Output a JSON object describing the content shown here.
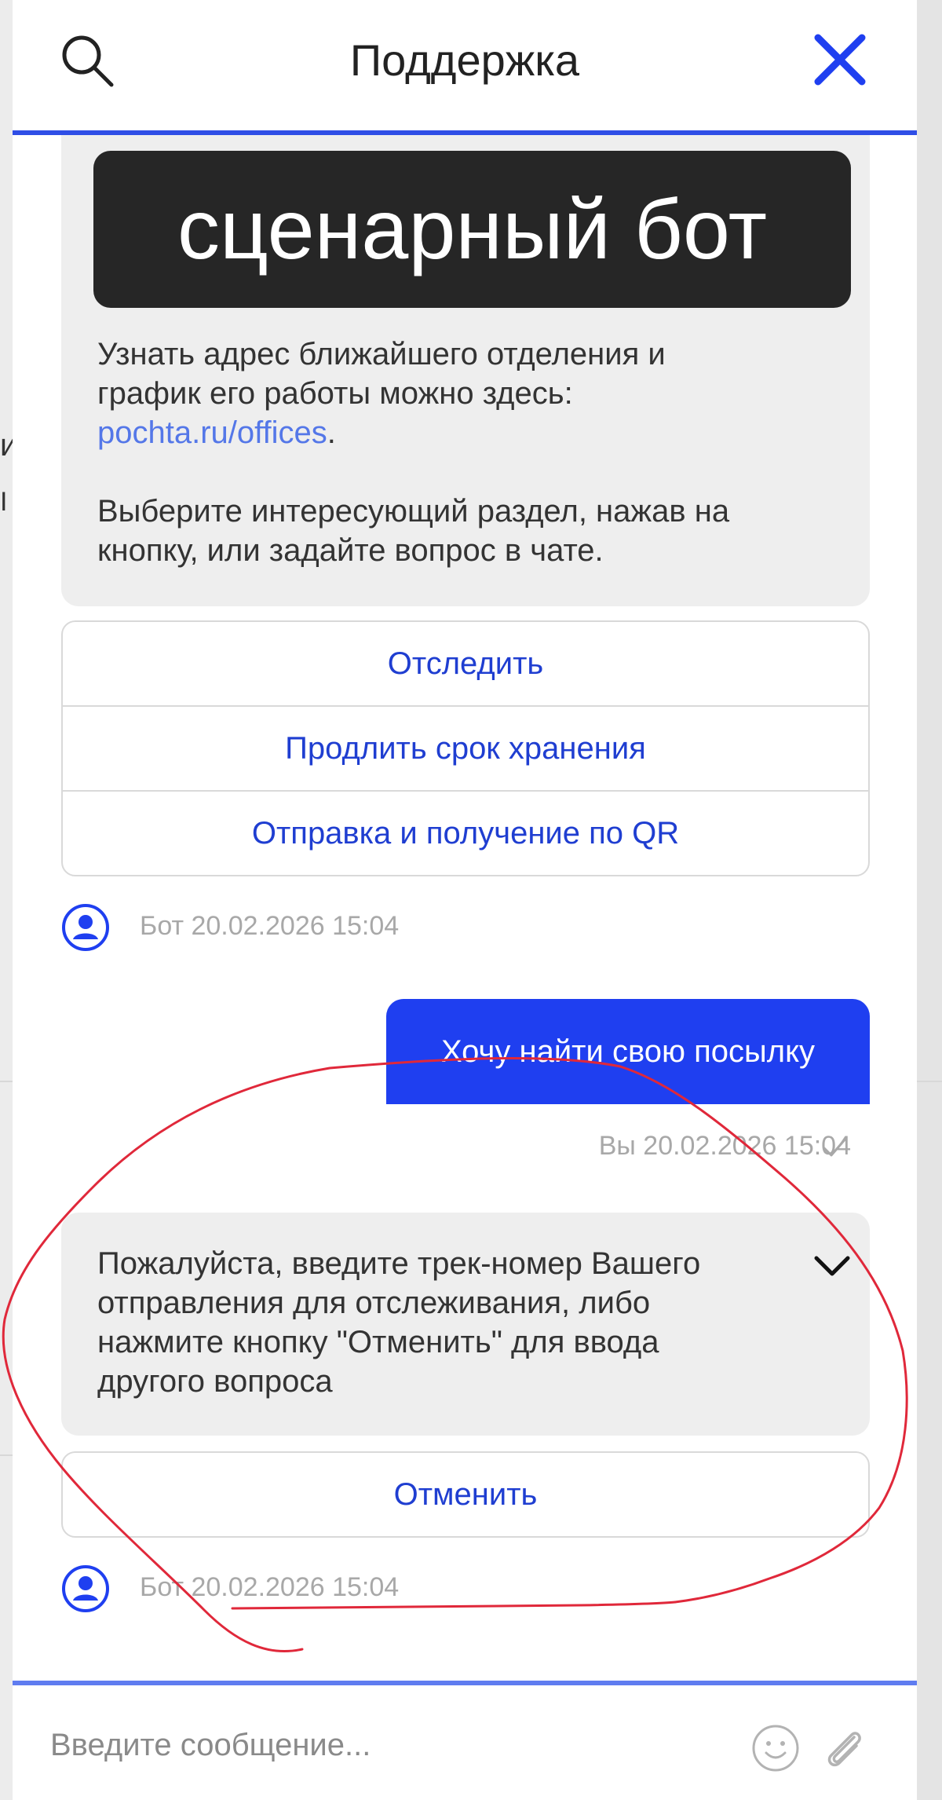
{
  "header": {
    "title": "Поддержка"
  },
  "overlay_label": "сценарный бот",
  "messages": {
    "bot1": {
      "text_line1": "Узнать адрес ближайшего отделения и",
      "text_line2": "график его работы можно здесь:",
      "link": "pochta.ru/offices",
      "link_suffix": ".",
      "text_line3": "Выберите интересующий раздел, нажав на",
      "text_line4": "кнопку, или задайте вопрос в чате."
    },
    "quick_replies": [
      "Отследить",
      "Продлить срок хранения",
      "Отправка и получение по QR"
    ],
    "bot1_meta": "Бот 20.02.2026 15:04",
    "user": {
      "text": "Хочу найти свою посылку",
      "meta": "Вы 20.02.2026 15:04"
    },
    "bot2": {
      "line1": "Пожалуйста, введите трек-номер Вашего",
      "line2": "отправления для отслеживания, либо",
      "line3": "нажмите кнопку \"Отменить\" для ввода",
      "line4": "другого вопроса"
    },
    "cancel_label": "Отменить",
    "bot2_meta": "Бот 20.02.2026 15:04"
  },
  "composer": {
    "placeholder": "Введите сообщение..."
  },
  "colors": {
    "accent": "#1f3ff0",
    "link": "#5477e8",
    "bubble": "#eeeeee",
    "annotation": "#e0283a"
  },
  "icons": [
    "search-icon",
    "close-icon",
    "avatar-icon",
    "check-icon",
    "chevron-down-icon",
    "emoji-icon",
    "paperclip-icon"
  ]
}
